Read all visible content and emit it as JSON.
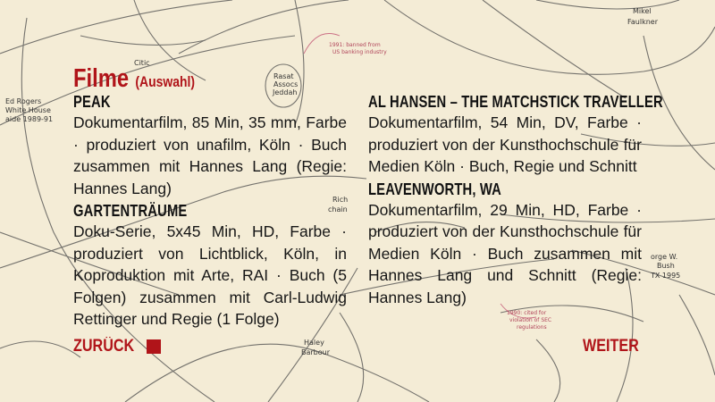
{
  "section": {
    "title": "Filme",
    "subtitle": "(Auswahl)"
  },
  "films": [
    {
      "title": "PEAK",
      "description": "Dokumentarfilm, 85 Min, 35 mm, Farbe · produziert von unafilm, Köln · Buch zusammen mit Hannes Lang (Regie: Hannes Lang)"
    },
    {
      "title": "GARTENTRÄUME",
      "description": "Doku-Serie, 5x45 Min, HD, Farbe · produziert von Lichtblick, Köln, in Koproduktion mit Arte, RAI · Buch (5 Folgen) zusammen mit Carl-Ludwig Rettinger und Regie (1 Folge)"
    },
    {
      "title": "AL HANSEN – THE MATCHSTICK TRAVELLER",
      "description": "Dokumentarfilm, 54 Min, DV, Farbe · produziert von der Kunsthochschule für Medien Köln · Buch, Regie und Schnitt"
    },
    {
      "title": "LEAVENWORTH, WA",
      "description": "Dokumentarfilm, 29 Min, HD, Farbe · produziert von der Kunsthochschule für Medien Köln · Buch zusammen mit Hannes Lang und Schnitt (Regie: Hannes Lang)"
    }
  ],
  "navigation": {
    "back_label": "ZURÜCK",
    "back_icon": "stop-square-icon",
    "next_label": "WEITER"
  },
  "background": {
    "notes": {
      "mikel": "Mikel",
      "faulkner": "Faulkner",
      "ed_rogers": "Ed Rogers",
      "white_house": "White House",
      "aide": "aide 1989-91",
      "rasat": "Rasat",
      "assocs": "Assocs",
      "jeddah": "Jeddah",
      "citic": "Citic",
      "rich": "Rich",
      "chain": "chain",
      "haley": "Haley",
      "barbour": "Barbour",
      "george": "orge W.",
      "bush": "Bush",
      "tx": "TX 1995",
      "banned1": "1991: banned from",
      "banned2": "US banking industry",
      "cited1": "1990: cited for",
      "cited2": "violation of SEC",
      "cited3": "regulations"
    }
  },
  "colors": {
    "accent": "#b01419",
    "background": "#f4ecd6",
    "text": "#161616",
    "annotation": "#b0445a"
  }
}
